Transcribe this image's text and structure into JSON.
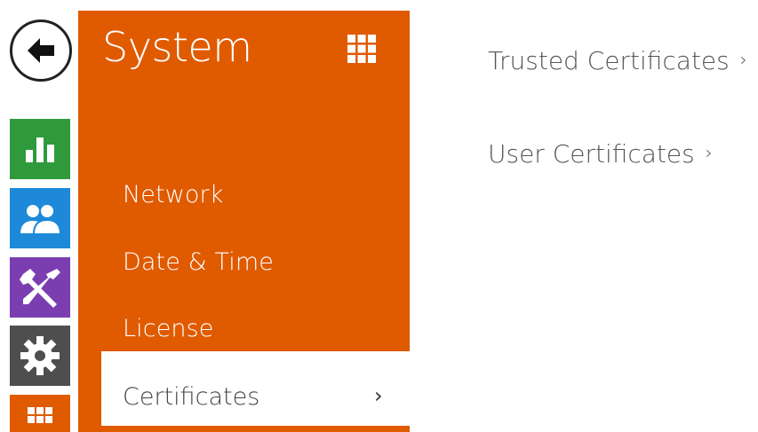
{
  "colors": {
    "accent_orange": "#e05a00",
    "tile_green": "#2e9a3c",
    "tile_blue": "#1d89d8",
    "tile_purple": "#7a3eb1",
    "tile_gray": "#4e4e4e"
  },
  "back": {
    "icon": "arrow-left-icon"
  },
  "rail": [
    {
      "icon": "bar-chart-icon"
    },
    {
      "icon": "users-icon"
    },
    {
      "icon": "tools-icon"
    },
    {
      "icon": "gear-icon"
    },
    {
      "icon": "grid-icon"
    }
  ],
  "panel": {
    "title": "System",
    "grid_icon": "grid-icon",
    "items": [
      {
        "label": "Network"
      },
      {
        "label": "Date & Time"
      },
      {
        "label": "License"
      },
      {
        "label": "Certificates",
        "chevron": "›"
      }
    ]
  },
  "main": {
    "links": [
      {
        "label": "Trusted Certificates",
        "chevron": "›"
      },
      {
        "label": "User Certificates",
        "chevron": "›"
      }
    ]
  }
}
